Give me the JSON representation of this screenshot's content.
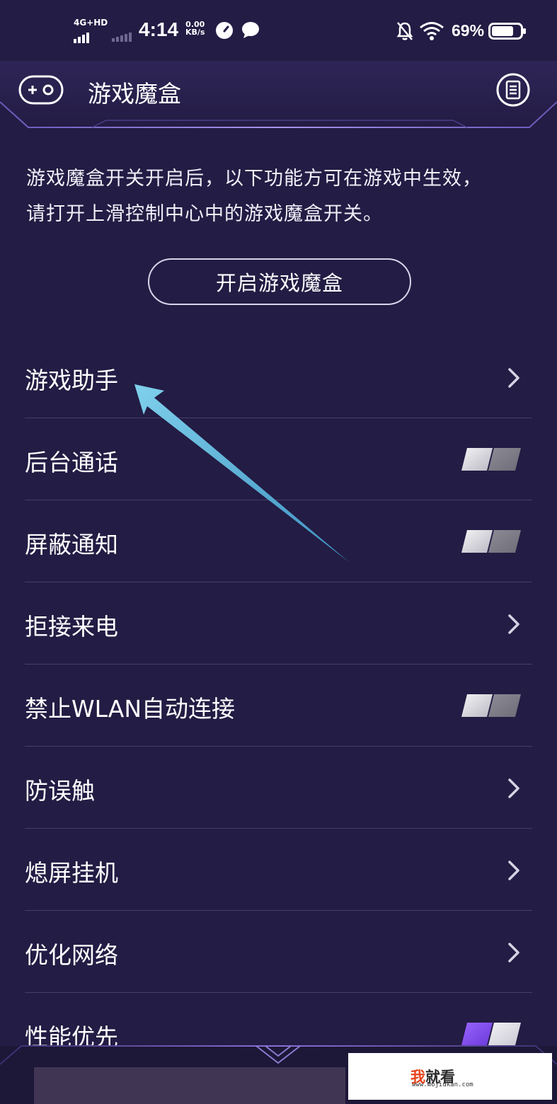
{
  "status_bar": {
    "network": "4G+HD",
    "time": "4:14",
    "speed_value": "0.00",
    "speed_unit": "KB/s",
    "battery": "69%"
  },
  "header": {
    "title": "游戏魔盒"
  },
  "description": {
    "line1": "游戏魔盒开关开启后，以下功能方可在游戏中生效，",
    "line2": "请打开上滑控制中心中的游戏魔盒开关。"
  },
  "enable_button": "开启游戏魔盒",
  "settings": [
    {
      "label": "游戏助手",
      "control": "chevron"
    },
    {
      "label": "后台通话",
      "control": "toggle",
      "on": false
    },
    {
      "label": "屏蔽通知",
      "control": "toggle",
      "on": false
    },
    {
      "label": "拒接来电",
      "control": "chevron"
    },
    {
      "label": "禁止WLAN自动连接",
      "control": "toggle",
      "on": false
    },
    {
      "label": "防误触",
      "control": "chevron"
    },
    {
      "label": "熄屏挂机",
      "control": "chevron"
    },
    {
      "label": "优化网络",
      "control": "chevron"
    },
    {
      "label": "性能优先",
      "control": "toggle",
      "on": true
    }
  ],
  "watermark": {
    "brand_first": "我",
    "brand_rest": "就看",
    "url": "www.wojiukan.com"
  },
  "colors": {
    "background": "#231c44",
    "accent": "#8a5cf0",
    "arrow": "#5fb8d8"
  }
}
